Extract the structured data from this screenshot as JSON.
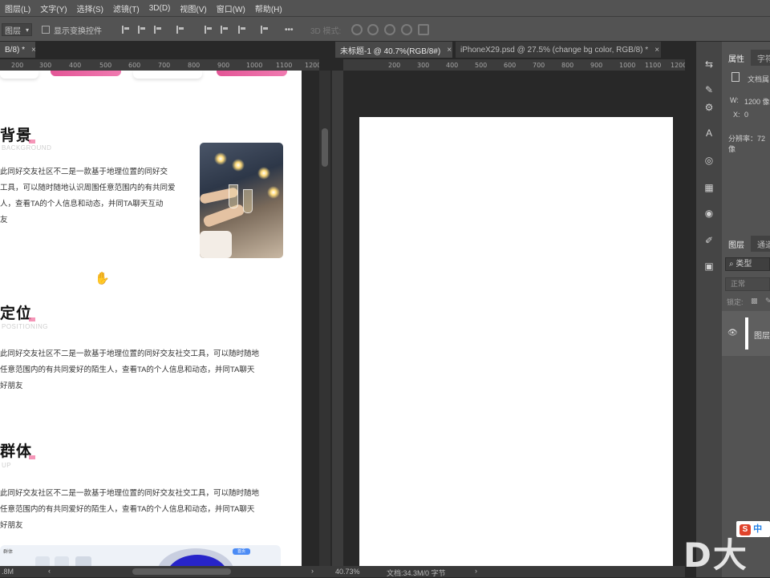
{
  "menubar": {
    "items": [
      "图层(L)",
      "文字(Y)",
      "选择(S)",
      "滤镜(T)",
      "3D(D)",
      "视图(V)",
      "窗口(W)",
      "帮助(H)"
    ]
  },
  "options": {
    "layer_dropdown": "图层",
    "show_transform_label": "显示变换控件",
    "more_label": "•••",
    "mode3d_label": "3D 模式:"
  },
  "left_doc": {
    "tab_title": "B/8) *",
    "tab_close": "×",
    "ruler_ticks": [
      "200",
      "300",
      "400",
      "500",
      "600",
      "700",
      "800",
      "900",
      "1000",
      "1100",
      "1200"
    ],
    "sections": [
      {
        "title": "背景",
        "subtitle": "BACKGROUND",
        "paragraph": "此同好交友社区不二是一款基于地理位置的同好交\n工具，可以随时随地认识周围任意范围内的有共同爱\n人，查看TA的个人信息和动态，并同TA聊天互动\n友"
      },
      {
        "title": "定位",
        "subtitle": "POSITIONING",
        "paragraph": "此同好交友社区不二是一款基于地理位置的同好交友社交工具，可以随时随地\n任意范围内的有共同爱好的陌生人，查看TA的个人信息和动态，并同TA聊天\n好朋友"
      },
      {
        "title": "群体",
        "subtitle": "UP",
        "paragraph": "此同好交友社区不二是一款基于地理位置的同好交友社交工具，可以随时随地\n任意范围内的有共同爱好的陌生人，查看TA的个人信息和动态，并同TA聊天\n好朋友"
      }
    ],
    "dash_chip": "首页",
    "dash_label": "群体",
    "status_text": ".8M"
  },
  "right_doc": {
    "tabs": [
      {
        "title": "未标题-1 @ 40.7%(RGB/8#)",
        "close": "×"
      },
      {
        "title": "iPhoneX29.psd @ 27.5% (change bg color, RGB/8) *",
        "close": "×"
      }
    ],
    "ruler_ticks": [
      "200",
      "300",
      "400",
      "500",
      "600",
      "700",
      "800",
      "900",
      "1000",
      "1100",
      "1200"
    ],
    "zoom": "40.73%",
    "doc_info": "文档:34.3M/0 字节"
  },
  "panels": {
    "properties_tab": "属性",
    "char_tab": "字符",
    "doc_label": "文档属",
    "w_label": "W:",
    "w_value": "1200 像",
    "x_label": "X:",
    "x_value": "0",
    "resolution": "分辨率：72 像",
    "layers_tab": "图层",
    "channels_tab": "通道",
    "search_kind": "类型",
    "blend_mode": "正常",
    "lock_label": "锁定:",
    "layer_name": "图层"
  },
  "watermark": {
    "ime": "中",
    "brand": "D大"
  }
}
